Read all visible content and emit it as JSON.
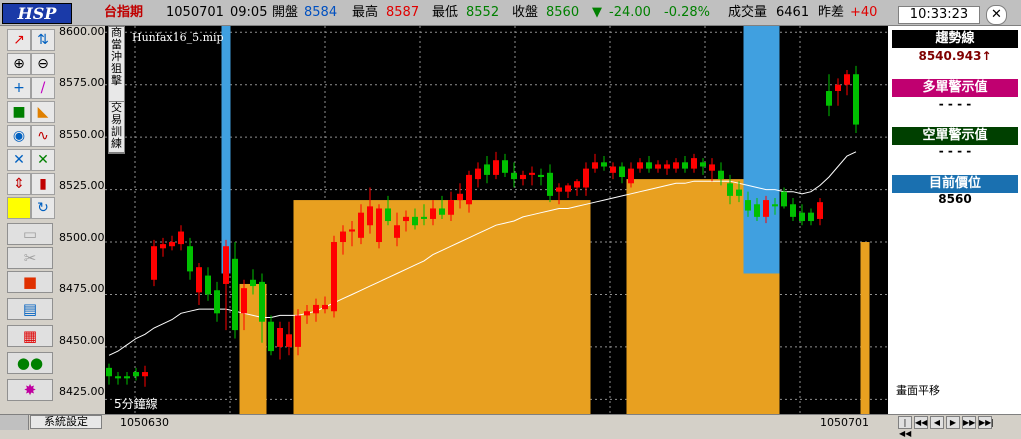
{
  "header": {
    "logo": "HSP",
    "symbol": "台指期",
    "date": "1050701",
    "time": "09:05",
    "open_label": "開盤",
    "open": "8584",
    "high_label": "最高",
    "high": "8587",
    "low_label": "最低",
    "low": "8552",
    "close_label": "收盤",
    "close": "8560",
    "change_arrow": "▼",
    "change": "-24.00",
    "change_pct": "-0.28%",
    "volume_label": "成交量",
    "volume": "6461",
    "spread_label": "昨差",
    "spread": "+40",
    "clock": "10:33:23",
    "close_icon": "✕"
  },
  "toolbar": {
    "icons": [
      "trend-line-icon",
      "split-icon",
      "zoom-in-icon",
      "zoom-out-icon",
      "crosshair-icon",
      "draw-line-icon",
      "lock-icon",
      "ruler-icon",
      "indicator-icon",
      "wave-icon",
      "compare-icon",
      "cross-icon",
      "up-down-icon",
      "candle-icon",
      "color-icon",
      "refresh-icon",
      "folder-icon",
      "scissors-icon",
      "stop-icon",
      "notes-icon",
      "grid-icon",
      "gloves-icon",
      "star-icon"
    ]
  },
  "yaxis": {
    "labels": [
      "8600.00",
      "8575.00",
      "8550.00",
      "8525.00",
      "8500.00",
      "8475.00",
      "8450.00",
      "8425.00"
    ]
  },
  "chart": {
    "file_label": "Hunfax16_5.mip",
    "period_label": "5分鐘線",
    "side_tab_1": "商\n當沖狙擊",
    "side_tab_2": "交易訓練",
    "x_start_label": "1050630",
    "x_end_label": "1050701",
    "colors": {
      "up": "#ff0000",
      "down": "#00c000",
      "band": "#e8a020",
      "signal": "#40a0e0"
    }
  },
  "chart_data": {
    "type": "candlestick",
    "ylim": [
      8418,
      8603
    ],
    "candles": [
      {
        "o": 8440,
        "h": 8442,
        "l": 8432,
        "c": 8436
      },
      {
        "o": 8436,
        "h": 8438,
        "l": 8432,
        "c": 8435
      },
      {
        "o": 8436,
        "h": 8438,
        "l": 8432,
        "c": 8435
      },
      {
        "o": 8438,
        "h": 8440,
        "l": 8434,
        "c": 8436
      },
      {
        "o": 8436,
        "h": 8441,
        "l": 8431,
        "c": 8438
      },
      {
        "o": 8482,
        "h": 8501,
        "l": 8479,
        "c": 8498
      },
      {
        "o": 8497,
        "h": 8502,
        "l": 8493,
        "c": 8499
      },
      {
        "o": 8498,
        "h": 8503,
        "l": 8496,
        "c": 8500
      },
      {
        "o": 8499,
        "h": 8508,
        "l": 8496,
        "c": 8505
      },
      {
        "o": 8498,
        "h": 8502,
        "l": 8482,
        "c": 8486
      },
      {
        "o": 8476,
        "h": 8490,
        "l": 8470,
        "c": 8488
      },
      {
        "o": 8484,
        "h": 8488,
        "l": 8472,
        "c": 8475
      },
      {
        "o": 8477,
        "h": 8481,
        "l": 8462,
        "c": 8466
      },
      {
        "o": 8480,
        "h": 8501,
        "l": 8458,
        "c": 8498
      },
      {
        "o": 8492,
        "h": 8500,
        "l": 8454,
        "c": 8458
      },
      {
        "o": 8466,
        "h": 8482,
        "l": 8458,
        "c": 8478
      },
      {
        "o": 8482,
        "h": 8487,
        "l": 8475,
        "c": 8479
      },
      {
        "o": 8481,
        "h": 8485,
        "l": 8452,
        "c": 8462
      },
      {
        "o": 8462,
        "h": 8465,
        "l": 8446,
        "c": 8448
      },
      {
        "o": 8450,
        "h": 8462,
        "l": 8444,
        "c": 8459
      },
      {
        "o": 8450,
        "h": 8462,
        "l": 8446,
        "c": 8456
      },
      {
        "o": 8450,
        "h": 8468,
        "l": 8446,
        "c": 8465
      },
      {
        "o": 8465,
        "h": 8470,
        "l": 8461,
        "c": 8467
      },
      {
        "o": 8466,
        "h": 8473,
        "l": 8462,
        "c": 8470
      },
      {
        "o": 8468,
        "h": 8474,
        "l": 8466,
        "c": 8470
      },
      {
        "o": 8467,
        "h": 8503,
        "l": 8464,
        "c": 8500
      },
      {
        "o": 8500,
        "h": 8508,
        "l": 8494,
        "c": 8505
      },
      {
        "o": 8505,
        "h": 8510,
        "l": 8498,
        "c": 8506
      },
      {
        "o": 8502,
        "h": 8518,
        "l": 8499,
        "c": 8514
      },
      {
        "o": 8508,
        "h": 8526,
        "l": 8504,
        "c": 8517
      },
      {
        "o": 8500,
        "h": 8518,
        "l": 8497,
        "c": 8516
      },
      {
        "o": 8516,
        "h": 8522,
        "l": 8508,
        "c": 8510
      },
      {
        "o": 8502,
        "h": 8514,
        "l": 8498,
        "c": 8508
      },
      {
        "o": 8510,
        "h": 8515,
        "l": 8505,
        "c": 8512
      },
      {
        "o": 8512,
        "h": 8516,
        "l": 8506,
        "c": 8508
      },
      {
        "o": 8512,
        "h": 8518,
        "l": 8508,
        "c": 8511
      },
      {
        "o": 8511,
        "h": 8520,
        "l": 8508,
        "c": 8516
      },
      {
        "o": 8516,
        "h": 8522,
        "l": 8511,
        "c": 8513
      },
      {
        "o": 8513,
        "h": 8524,
        "l": 8510,
        "c": 8520
      },
      {
        "o": 8520,
        "h": 8528,
        "l": 8516,
        "c": 8523
      },
      {
        "o": 8518,
        "h": 8534,
        "l": 8514,
        "c": 8532
      },
      {
        "o": 8530,
        "h": 8538,
        "l": 8526,
        "c": 8535
      },
      {
        "o": 8537,
        "h": 8541,
        "l": 8528,
        "c": 8532
      },
      {
        "o": 8532,
        "h": 8543,
        "l": 8530,
        "c": 8539
      },
      {
        "o": 8539,
        "h": 8542,
        "l": 8531,
        "c": 8533
      },
      {
        "o": 8533,
        "h": 8538,
        "l": 8526,
        "c": 8530
      },
      {
        "o": 8530,
        "h": 8534,
        "l": 8527,
        "c": 8532
      },
      {
        "o": 8532,
        "h": 8536,
        "l": 8527,
        "c": 8533
      },
      {
        "o": 8532,
        "h": 8535,
        "l": 8527,
        "c": 8531
      },
      {
        "o": 8533,
        "h": 8537,
        "l": 8519,
        "c": 8522
      },
      {
        "o": 8524,
        "h": 8528,
        "l": 8518,
        "c": 8526
      },
      {
        "o": 8524,
        "h": 8528,
        "l": 8521,
        "c": 8527
      },
      {
        "o": 8526,
        "h": 8530,
        "l": 8522,
        "c": 8529
      },
      {
        "o": 8526,
        "h": 8538,
        "l": 8522,
        "c": 8535
      },
      {
        "o": 8535,
        "h": 8542,
        "l": 8533,
        "c": 8538
      },
      {
        "o": 8538,
        "h": 8541,
        "l": 8534,
        "c": 8536
      },
      {
        "o": 8533,
        "h": 8538,
        "l": 8530,
        "c": 8536
      },
      {
        "o": 8536,
        "h": 8538,
        "l": 8528,
        "c": 8531
      },
      {
        "o": 8528,
        "h": 8538,
        "l": 8526,
        "c": 8535
      },
      {
        "o": 8535,
        "h": 8540,
        "l": 8533,
        "c": 8538
      },
      {
        "o": 8538,
        "h": 8541,
        "l": 8533,
        "c": 8535
      },
      {
        "o": 8535,
        "h": 8539,
        "l": 8533,
        "c": 8537
      },
      {
        "o": 8535,
        "h": 8539,
        "l": 8532,
        "c": 8537
      },
      {
        "o": 8535,
        "h": 8540,
        "l": 8533,
        "c": 8538
      },
      {
        "o": 8538,
        "h": 8541,
        "l": 8533,
        "c": 8535
      },
      {
        "o": 8535,
        "h": 8542,
        "l": 8533,
        "c": 8540
      },
      {
        "o": 8538,
        "h": 8540,
        "l": 8532,
        "c": 8536
      },
      {
        "o": 8534,
        "h": 8540,
        "l": 8529,
        "c": 8537
      },
      {
        "o": 8534,
        "h": 8538,
        "l": 8527,
        "c": 8530
      },
      {
        "o": 8528,
        "h": 8532,
        "l": 8518,
        "c": 8522
      },
      {
        "o": 8525,
        "h": 8529,
        "l": 8519,
        "c": 8522
      },
      {
        "o": 8520,
        "h": 8524,
        "l": 8512,
        "c": 8515
      },
      {
        "o": 8518,
        "h": 8521,
        "l": 8510,
        "c": 8512
      },
      {
        "o": 8512,
        "h": 8522,
        "l": 8509,
        "c": 8520
      },
      {
        "o": 8518,
        "h": 8521,
        "l": 8513,
        "c": 8517
      },
      {
        "o": 8524,
        "h": 8526,
        "l": 8516,
        "c": 8517
      },
      {
        "o": 8518,
        "h": 8521,
        "l": 8510,
        "c": 8512
      },
      {
        "o": 8514,
        "h": 8518,
        "l": 8508,
        "c": 8510
      },
      {
        "o": 8514,
        "h": 8516,
        "l": 8508,
        "c": 8510
      },
      {
        "o": 8511,
        "h": 8521,
        "l": 8508,
        "c": 8519
      },
      {
        "o": 8572,
        "h": 8580,
        "l": 8560,
        "c": 8565
      },
      {
        "o": 8572,
        "h": 8578,
        "l": 8565,
        "c": 8575
      },
      {
        "o": 8575,
        "h": 8582,
        "l": 8570,
        "c": 8580
      },
      {
        "o": 8580,
        "h": 8584,
        "l": 8552,
        "c": 8556
      }
    ],
    "ma": [
      8446,
      8448,
      8451,
      8454,
      8456,
      8459,
      8461,
      8463,
      8466,
      8467,
      8468,
      8468,
      8468,
      8468,
      8467,
      8466,
      8465,
      8464,
      8464,
      8465,
      8465,
      8465,
      8466,
      8467,
      8469,
      8471,
      8473,
      8475,
      8477,
      8479,
      8481,
      8483,
      8485,
      8487,
      8489,
      8491,
      8494,
      8496,
      8498,
      8500,
      8502,
      8504,
      8506,
      8508,
      8509,
      8510,
      8512,
      8513,
      8514,
      8515,
      8516,
      8516,
      8517,
      8518,
      8519,
      8520,
      8521,
      8522,
      8523,
      8524,
      8525,
      8526,
      8527,
      8528,
      8528,
      8529,
      8529,
      8529,
      8529,
      8529,
      8528,
      8527,
      8526,
      8525,
      8525,
      8524,
      8524,
      8523,
      8524,
      8527,
      8531,
      8536,
      8541,
      8543
    ],
    "signal_bars": [
      {
        "from": 13,
        "to": 13
      },
      {
        "from": 71,
        "to": 74
      }
    ],
    "band_bars": [
      {
        "from": 15,
        "to": 17,
        "top": 8480
      },
      {
        "from": 21,
        "to": 53,
        "top": 8520
      },
      {
        "from": 58,
        "to": 74,
        "top": 8530
      },
      {
        "from": 84,
        "to": 84,
        "top": 8500
      }
    ]
  },
  "panel": {
    "trend_label": "趨勢線",
    "trend_value": "8540.943↑",
    "long_label": "多單警示值",
    "long_value": "- - - -",
    "short_label": "空單警示值",
    "short_value": "- - - -",
    "position_label": "目前價位",
    "position_value": "8560",
    "status": "畫面平移"
  },
  "bottom": {
    "settings": "系統設定",
    "nav": [
      "|◀◀",
      "◀◀",
      "◀",
      "▶",
      "▶▶",
      "▶▶|"
    ]
  }
}
